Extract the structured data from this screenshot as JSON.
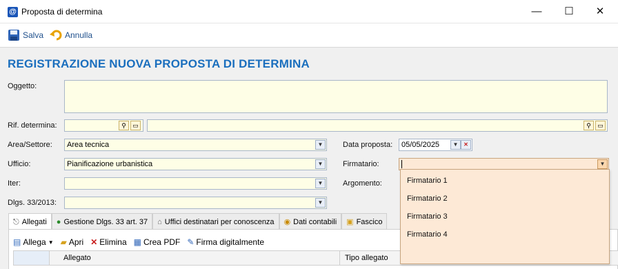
{
  "window": {
    "title": "Proposta di determina",
    "minimize_glyph": "—",
    "maximize_glyph": "☐",
    "close_glyph": "✕"
  },
  "toolbar": {
    "save_label": "Salva",
    "cancel_label": "Annulla"
  },
  "form": {
    "title": "REGISTRAZIONE NUOVA PROPOSTA DI DETERMINA",
    "oggetto": {
      "label": "Oggetto:",
      "value": ""
    },
    "rif_determina": {
      "label": "Rif. determina:",
      "value": "",
      "value2": ""
    },
    "area_settore": {
      "label": "Area/Settore:",
      "value": "Area tecnica"
    },
    "ufficio": {
      "label": "Ufficio:",
      "value": "Pianificazione urbanistica"
    },
    "iter": {
      "label": "Iter:",
      "value": ""
    },
    "dlgs": {
      "label": "Dlgs. 33/2013:",
      "value": ""
    },
    "data_proposta": {
      "label": "Data proposta:",
      "value": "05/05/2025"
    },
    "firmatario": {
      "label": "Firmatario:",
      "value": ""
    },
    "argomento": {
      "label": "Argomento:"
    }
  },
  "firmatario_dropdown": {
    "options": [
      "Firmatario 1",
      "Firmatario 2",
      "Firmatario 3",
      "Firmatario 4"
    ]
  },
  "tabs": [
    {
      "label": "Allegati",
      "active": true
    },
    {
      "label": "Gestione Dlgs. 33 art. 37"
    },
    {
      "label": "Uffici destinatari per conoscenza"
    },
    {
      "label": "Dati contabili"
    },
    {
      "label": "Fascico"
    }
  ],
  "attachments": {
    "toolbar": {
      "allega": "Allega",
      "apri": "Apri",
      "elimina": "Elimina",
      "crea_pdf": "Crea PDF",
      "firma": "Firma digitalmente"
    },
    "columns": [
      "Allegato",
      "Tipo allegato"
    ]
  },
  "colors": {
    "title_blue": "#1b6fbe",
    "field_bg": "#fefee6",
    "dropdown_bg": "#fde9d6"
  }
}
